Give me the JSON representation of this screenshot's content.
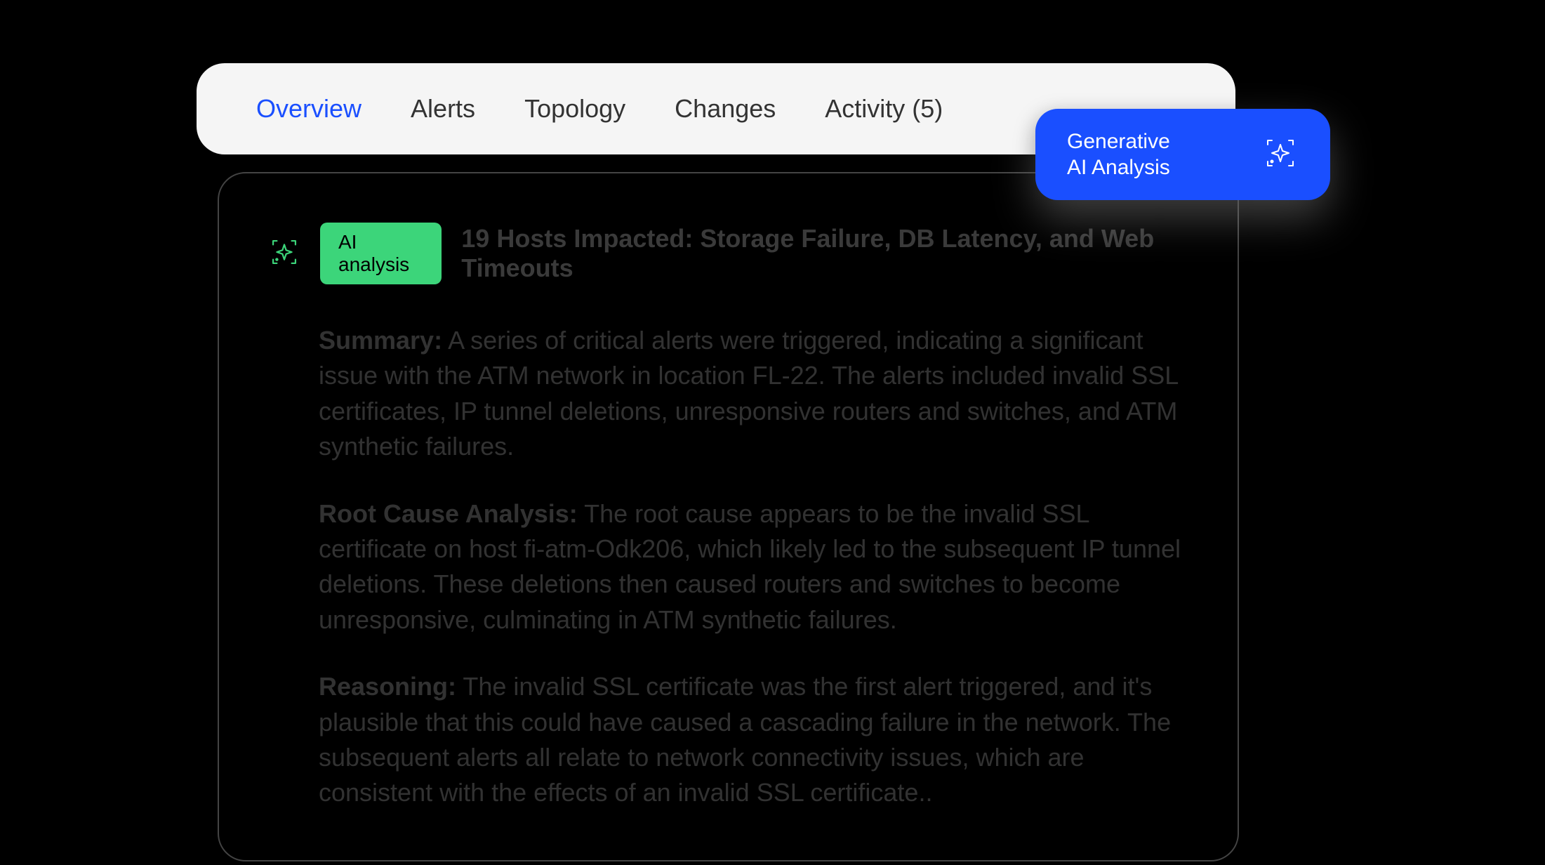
{
  "tabs": {
    "overview": "Overview",
    "alerts": "Alerts",
    "topology": "Topology",
    "changes": "Changes",
    "activity": "Activity (5)"
  },
  "gen_ai_button": {
    "line1": "Generative",
    "line2": "AI Analysis"
  },
  "panel": {
    "badge": "AI analysis",
    "title": "19 Hosts Impacted: Storage Failure, DB Latency, and Web Timeouts",
    "summary_label": "Summary:",
    "summary_text": " A series of critical alerts were triggered, indicating a significant issue with the ATM network in location FL-22. The alerts included invalid SSL certificates, IP tunnel deletions, unresponsive routers and switches, and ATM synthetic failures.",
    "rca_label": "Root Cause Analysis:",
    "rca_text": " The root cause appears to be the invalid SSL certificate on host fi-atm-Odk206, which likely led to the subsequent IP tunnel deletions. These deletions then caused routers and switches to become unresponsive, culminating in ATM synthetic failures.",
    "reasoning_label": "Reasoning:",
    "reasoning_text": " The invalid SSL certificate was the first alert triggered, and it's plausible that this could have caused a cascading failure in the network. The subsequent alerts all relate to network connectivity issues, which are consistent with the effects of an invalid SSL certificate.."
  }
}
